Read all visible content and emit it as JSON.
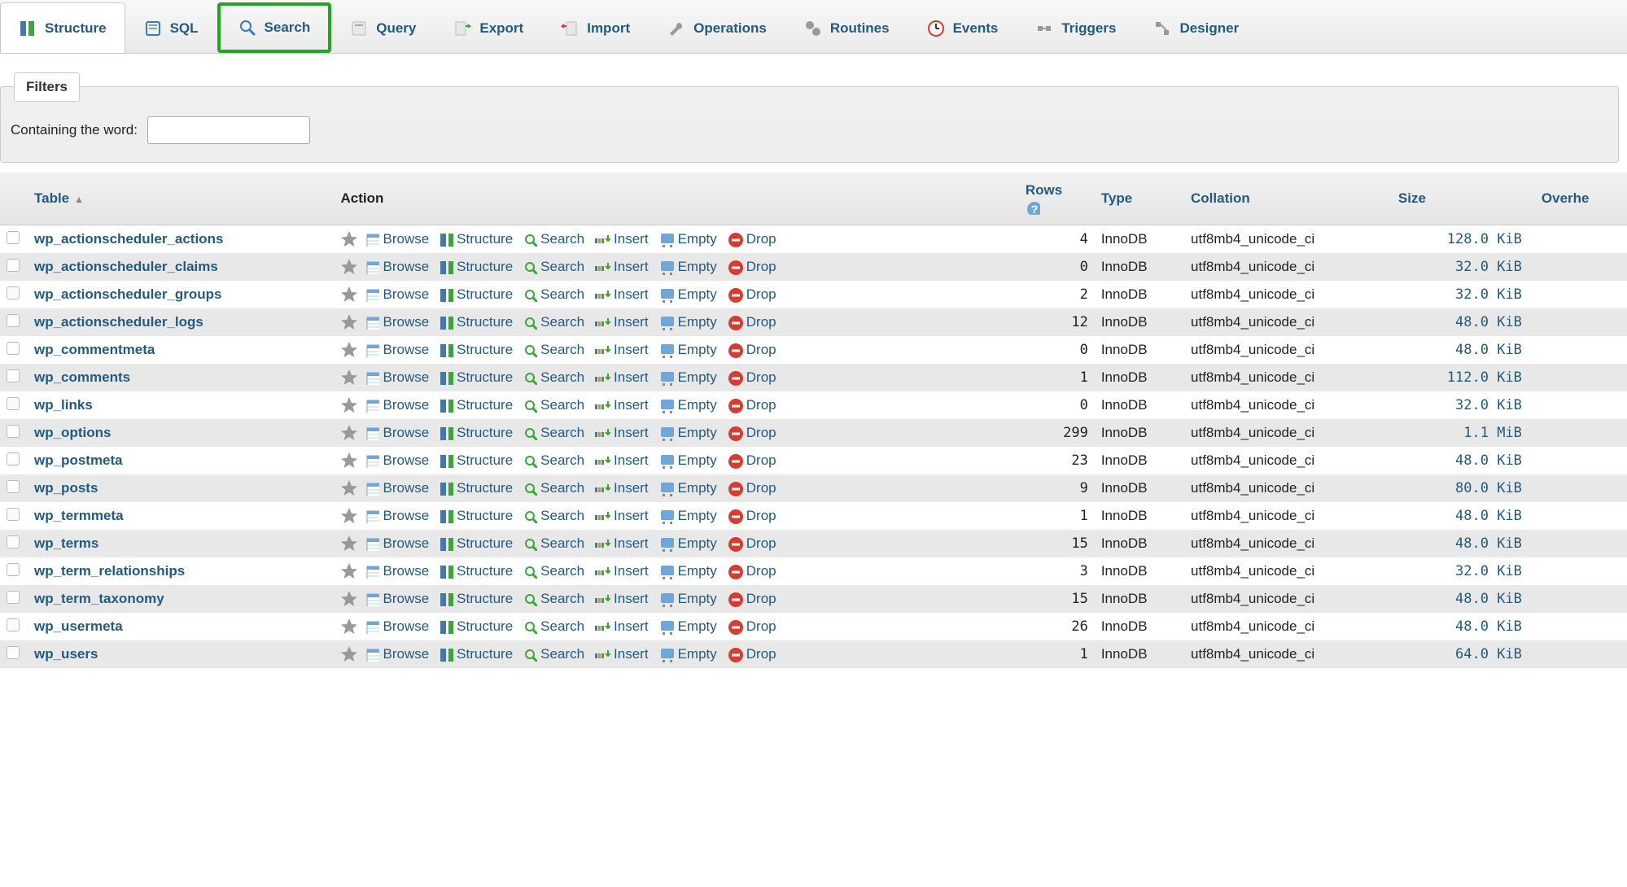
{
  "tabs": [
    {
      "label": "Structure",
      "active": true
    },
    {
      "label": "SQL"
    },
    {
      "label": "Search",
      "highlight": true
    },
    {
      "label": "Query"
    },
    {
      "label": "Export"
    },
    {
      "label": "Import"
    },
    {
      "label": "Operations"
    },
    {
      "label": "Routines"
    },
    {
      "label": "Events"
    },
    {
      "label": "Triggers"
    },
    {
      "label": "Designer"
    }
  ],
  "filters": {
    "panel_label": "Filters",
    "containing_label": "Containing the word:",
    "value": ""
  },
  "columns": {
    "table": "Table",
    "action": "Action",
    "rows": "Rows",
    "type": "Type",
    "collation": "Collation",
    "size": "Size",
    "overhead": "Overhe"
  },
  "row_actions": {
    "browse": "Browse",
    "structure": "Structure",
    "search": "Search",
    "insert": "Insert",
    "empty": "Empty",
    "drop": "Drop"
  },
  "tables": [
    {
      "name": "wp_actionscheduler_actions",
      "rows": 4,
      "type": "InnoDB",
      "collation": "utf8mb4_unicode_ci",
      "size": "128.0 KiB"
    },
    {
      "name": "wp_actionscheduler_claims",
      "rows": 0,
      "type": "InnoDB",
      "collation": "utf8mb4_unicode_ci",
      "size": "32.0 KiB"
    },
    {
      "name": "wp_actionscheduler_groups",
      "rows": 2,
      "type": "InnoDB",
      "collation": "utf8mb4_unicode_ci",
      "size": "32.0 KiB"
    },
    {
      "name": "wp_actionscheduler_logs",
      "rows": 12,
      "type": "InnoDB",
      "collation": "utf8mb4_unicode_ci",
      "size": "48.0 KiB"
    },
    {
      "name": "wp_commentmeta",
      "rows": 0,
      "type": "InnoDB",
      "collation": "utf8mb4_unicode_ci",
      "size": "48.0 KiB"
    },
    {
      "name": "wp_comments",
      "rows": 1,
      "type": "InnoDB",
      "collation": "utf8mb4_unicode_ci",
      "size": "112.0 KiB"
    },
    {
      "name": "wp_links",
      "rows": 0,
      "type": "InnoDB",
      "collation": "utf8mb4_unicode_ci",
      "size": "32.0 KiB"
    },
    {
      "name": "wp_options",
      "rows": 299,
      "type": "InnoDB",
      "collation": "utf8mb4_unicode_ci",
      "size": "1.1 MiB"
    },
    {
      "name": "wp_postmeta",
      "rows": 23,
      "type": "InnoDB",
      "collation": "utf8mb4_unicode_ci",
      "size": "48.0 KiB"
    },
    {
      "name": "wp_posts",
      "rows": 9,
      "type": "InnoDB",
      "collation": "utf8mb4_unicode_ci",
      "size": "80.0 KiB"
    },
    {
      "name": "wp_termmeta",
      "rows": 1,
      "type": "InnoDB",
      "collation": "utf8mb4_unicode_ci",
      "size": "48.0 KiB"
    },
    {
      "name": "wp_terms",
      "rows": 15,
      "type": "InnoDB",
      "collation": "utf8mb4_unicode_ci",
      "size": "48.0 KiB"
    },
    {
      "name": "wp_term_relationships",
      "rows": 3,
      "type": "InnoDB",
      "collation": "utf8mb4_unicode_ci",
      "size": "32.0 KiB"
    },
    {
      "name": "wp_term_taxonomy",
      "rows": 15,
      "type": "InnoDB",
      "collation": "utf8mb4_unicode_ci",
      "size": "48.0 KiB"
    },
    {
      "name": "wp_usermeta",
      "rows": 26,
      "type": "InnoDB",
      "collation": "utf8mb4_unicode_ci",
      "size": "48.0 KiB"
    },
    {
      "name": "wp_users",
      "rows": 1,
      "type": "InnoDB",
      "collation": "utf8mb4_unicode_ci",
      "size": "64.0 KiB"
    }
  ]
}
